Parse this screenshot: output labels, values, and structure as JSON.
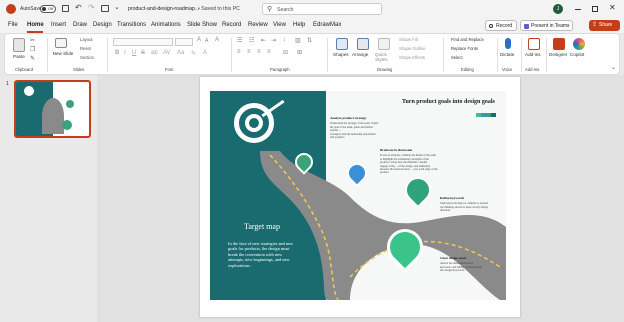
{
  "titlebar": {
    "autosave_label": "AutoSave",
    "autosave_state": "Off",
    "file_name": "product-and-design-roadmap...",
    "save_status": "• Saved to this PC",
    "search_placeholder": "Search",
    "avatar_initial": "J"
  },
  "tabs": [
    "File",
    "Home",
    "Insert",
    "Draw",
    "Design",
    "Transitions",
    "Animations",
    "Slide Show",
    "Record",
    "Review",
    "View",
    "Help",
    "EdrawMax"
  ],
  "active_tab": "Home",
  "actions": {
    "record": "Record",
    "present": "Present in Teams",
    "share": "Share"
  },
  "ribbon": {
    "clipboard": {
      "paste": "Paste",
      "group": "Clipboard"
    },
    "slides": {
      "new_slide": "New Slide",
      "layout": "Layout",
      "reset": "Reset",
      "section": "Section",
      "group": "Slides"
    },
    "font": {
      "group": "Font"
    },
    "paragraph": {
      "group": "Paragraph"
    },
    "drawing": {
      "shapes": "Shapes",
      "arrange": "Arrange",
      "quick_styles": "Quick Styles",
      "shape_fill": "Shape Fill",
      "shape_outline": "Shape Outline",
      "shape_effects": "Shape Effects",
      "group": "Drawing"
    },
    "editing": {
      "find_replace": "Find and Replace",
      "replace_fonts": "Replace Fonts",
      "select": "Select",
      "group": "Editing"
    },
    "voice": {
      "dictate": "Dictate",
      "group": "Voice"
    },
    "addins": {
      "add_ins": "Add-ins",
      "group": "Add-ins"
    },
    "designer": "Designer",
    "copilot": "Copilot"
  },
  "slide_panel": {
    "slide_number": "1"
  },
  "slide": {
    "header": "Turn product goals into design goals",
    "left_title": "Target map",
    "left_body": [
      "In the face of new strategies and new",
      "goals for products, the design must",
      "break the convention with new",
      "attempts, new beginnings, and new",
      "explorations ."
    ],
    "items": [
      {
        "title": "Analyze product strategy",
        "lines": [
          "Understand the strategy of the team, clarify",
          "the goal of the team, guide and further",
          "expand ...",
          "strategies with the marketing department",
          "and products."
        ]
      },
      {
        "title": "Brainstorm discussion",
        "lines": [
          "Focus on analysis, combine the theme of the team",
          "to highlight the preliminary strengths of the",
          "products, adopt new mechanisms, visually",
          "engage at the ... of the design, and ultimately",
          "measure the fresh and new ... over each stage of the",
          "product."
        ]
      },
      {
        "title": "Refine keywords",
        "lines": [
          "Then keywords help us continue to expand",
          "our thinking and let us more clearly design",
          "direction."
        ]
      },
      {
        "title": "Clear design goals",
        "lines": [
          "And let me disassemble these",
          "keywords, and finally transform them",
          "into design keywords."
        ]
      }
    ]
  },
  "colors": {
    "accent": "#c43e1c",
    "teal": "#1a6b70",
    "green": "#3aa37a",
    "road": "#8a8a8a"
  }
}
